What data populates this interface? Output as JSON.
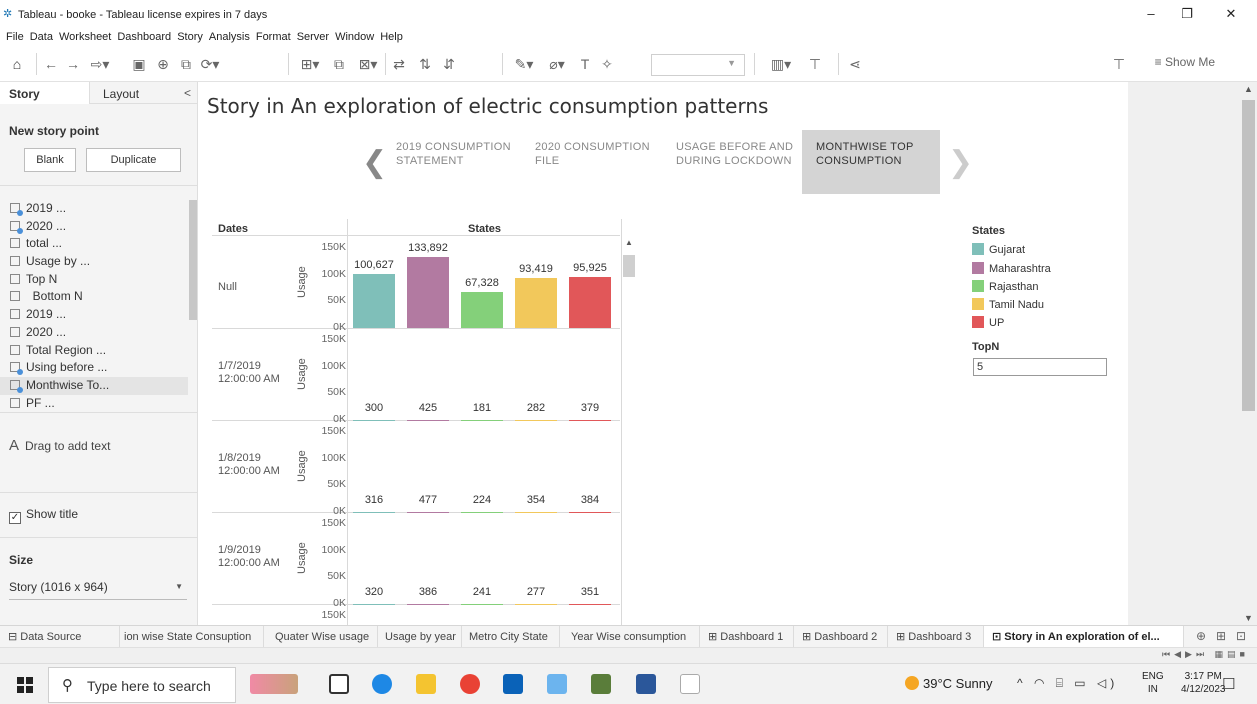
{
  "window": {
    "title": "Tableau - booke - Tableau license expires in 7 days",
    "minimize": "–",
    "restore": "❐",
    "close": "✕"
  },
  "menu": [
    "File",
    "Data",
    "Worksheet",
    "Dashboard",
    "Story",
    "Analysis",
    "Format",
    "Server",
    "Window",
    "Help"
  ],
  "toolbar": {
    "show_me": "Show Me"
  },
  "left_panel": {
    "tab_story": "Story",
    "tab_layout": "Layout",
    "collapse": "<",
    "new_story_point": "New story point",
    "blank_button": "Blank",
    "duplicate_button": "Duplicate",
    "sheets": [
      {
        "label": "2019 ...",
        "dashboard": true
      },
      {
        "label": "2020 ...",
        "dashboard": true
      },
      {
        "label": "total ...",
        "dashboard": false
      },
      {
        "label": "Usage by ...",
        "dashboard": false
      },
      {
        "label": "Top N",
        "dashboard": false
      },
      {
        "label": "  Bottom N",
        "dashboard": false
      },
      {
        "label": "2019 ...",
        "dashboard": false
      },
      {
        "label": "2020 ...",
        "dashboard": false
      },
      {
        "label": "Total Region ...",
        "dashboard": false
      },
      {
        "label": "Using before ...",
        "dashboard": true
      },
      {
        "label": "Monthwise To...",
        "dashboard": true
      },
      {
        "label": "PF ...",
        "dashboard": false
      }
    ],
    "drag_text_icon": "A",
    "drag_text": "Drag to add text",
    "show_title": "Show title",
    "show_title_checked": "✓",
    "size_heading": "Size",
    "size_value": "Story (1016 x 964)"
  },
  "story": {
    "title": "Story in An exploration of electric consumption patterns",
    "prev_arrow": "❮",
    "next_arrow": "❯",
    "points": [
      {
        "line1": "2019 CONSUMPTION",
        "line2": "STATEMENT",
        "active": false
      },
      {
        "line1": "2020 CONSUMPTION",
        "line2": "FILE",
        "active": false
      },
      {
        "line1": "USAGE BEFORE AND",
        "line2": "DURING LOCKDOWN",
        "active": false
      },
      {
        "line1": "MONTHWISE TOP",
        "line2": "CONSUMPTION",
        "active": true
      }
    ]
  },
  "viz": {
    "header_dates": "Dates",
    "header_states": "States",
    "usage_label": "Usage",
    "ticks": [
      "150K",
      "100K",
      "50K",
      "0K"
    ],
    "rows": [
      {
        "date": "Null",
        "time": "",
        "values": [
          "100,627",
          "133,892",
          "67,328",
          "93,419",
          "95,925"
        ]
      },
      {
        "date": "1/7/2019",
        "time": "12:00:00 AM",
        "values": [
          "300",
          "425",
          "181",
          "282",
          "379"
        ]
      },
      {
        "date": "1/8/2019",
        "time": "12:00:00 AM",
        "values": [
          "316",
          "477",
          "224",
          "354",
          "384"
        ]
      },
      {
        "date": "1/9/2019",
        "time": "12:00:00 AM",
        "values": [
          "320",
          "386",
          "241",
          "277",
          "351"
        ]
      }
    ],
    "last_tick": "150K"
  },
  "chart_data": {
    "type": "bar",
    "categories": [
      "Gujarat",
      "Maharashtra",
      "Rajasthan",
      "Tamil Nadu",
      "UP"
    ],
    "series": [
      {
        "name": "Null",
        "values": [
          100627,
          133892,
          67328,
          93419,
          95925
        ]
      },
      {
        "name": "1/7/2019 12:00:00 AM",
        "values": [
          300,
          425,
          181,
          282,
          379
        ]
      },
      {
        "name": "1/8/2019 12:00:00 AM",
        "values": [
          316,
          477,
          224,
          354,
          384
        ]
      },
      {
        "name": "1/9/2019 12:00:00 AM",
        "values": [
          320,
          386,
          241,
          277,
          351
        ]
      }
    ],
    "xlabel": "States",
    "ylabel": "Usage",
    "ylim": [
      0,
      150000
    ],
    "colors": [
      "#7fbfb9",
      "#b27aa1",
      "#84d07a",
      "#f2c85b",
      "#e15759"
    ],
    "legend_position": "right"
  },
  "legend": {
    "title": "States",
    "items": [
      {
        "label": "Gujarat",
        "color": "#7fbfb9"
      },
      {
        "label": "Maharashtra",
        "color": "#b27aa1"
      },
      {
        "label": "Rajasthan",
        "color": "#84d07a"
      },
      {
        "label": "Tamil Nadu",
        "color": "#f2c85b"
      },
      {
        "label": "UP",
        "color": "#e15759"
      }
    ],
    "topn_label": "TopN",
    "topn_value": "5"
  },
  "sheet_tabs": [
    {
      "label": "Data Source",
      "icon": "⊟",
      "active": false
    },
    {
      "label": "ion wise State Consuption",
      "icon": "",
      "active": false
    },
    {
      "label": "Quater Wise usage",
      "icon": "",
      "active": false
    },
    {
      "label": "Usage by year",
      "icon": "",
      "active": false
    },
    {
      "label": "Metro City State",
      "icon": "",
      "active": false
    },
    {
      "label": "Year Wise consumption",
      "icon": "",
      "active": false
    },
    {
      "label": "Dashboard 1",
      "icon": "⊞",
      "active": false
    },
    {
      "label": "Dashboard 2",
      "icon": "⊞",
      "active": false
    },
    {
      "label": "Dashboard 3",
      "icon": "⊞",
      "active": false
    },
    {
      "label": "Story in An exploration of el...",
      "icon": "⊡",
      "active": true
    }
  ],
  "taskbar": {
    "search_placeholder": "Type here to search",
    "weather": "39°C  Sunny",
    "lang_line1": "ENG",
    "lang_line2": "IN",
    "time": "3:17 PM",
    "date": "4/12/2023"
  }
}
